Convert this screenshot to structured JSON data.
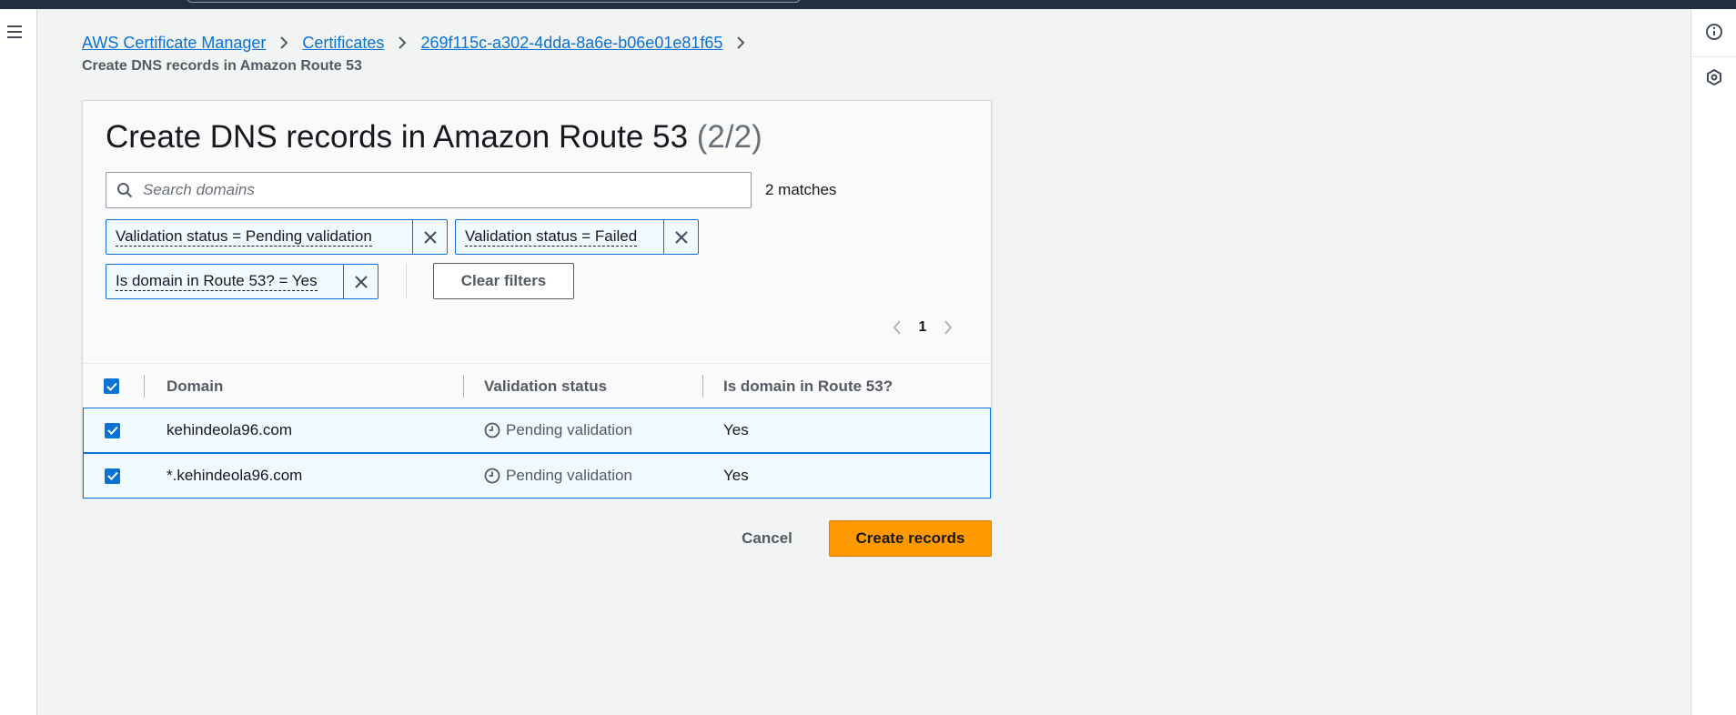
{
  "breadcrumbs": {
    "items": [
      "AWS Certificate Manager",
      "Certificates",
      "269f115c-a302-4dda-8a6e-b06e01e81f65"
    ],
    "current": "Create DNS records in Amazon Route 53"
  },
  "panel": {
    "title": "Create DNS records in Amazon Route 53",
    "count": "(2/2)"
  },
  "search": {
    "placeholder": "Search domains",
    "value": "",
    "matches": "2 matches"
  },
  "filters": [
    "Validation status = Pending validation",
    "Validation status = Failed",
    "Is domain in Route 53? = Yes"
  ],
  "clear_filters_label": "Clear filters",
  "pagination": {
    "current_page": "1"
  },
  "table": {
    "columns": [
      "Domain",
      "Validation status",
      "Is domain in Route 53?"
    ],
    "rows": [
      {
        "selected": true,
        "domain": "kehindeola96.com",
        "status": "Pending validation",
        "in_route53": "Yes"
      },
      {
        "selected": true,
        "domain": "*.kehindeola96.com",
        "status": "Pending validation",
        "in_route53": "Yes"
      }
    ]
  },
  "actions": {
    "cancel_label": "Cancel",
    "primary_label": "Create records"
  },
  "colors": {
    "primary_button": "#ff9900",
    "link": "#0972d3",
    "selected_row_bg": "#f1faff",
    "top_nav": "#232f3e"
  },
  "icons": {
    "left_rail": "hamburger-menu-icon",
    "right_rail": [
      "info-icon",
      "settings-hexagon-icon"
    ]
  }
}
